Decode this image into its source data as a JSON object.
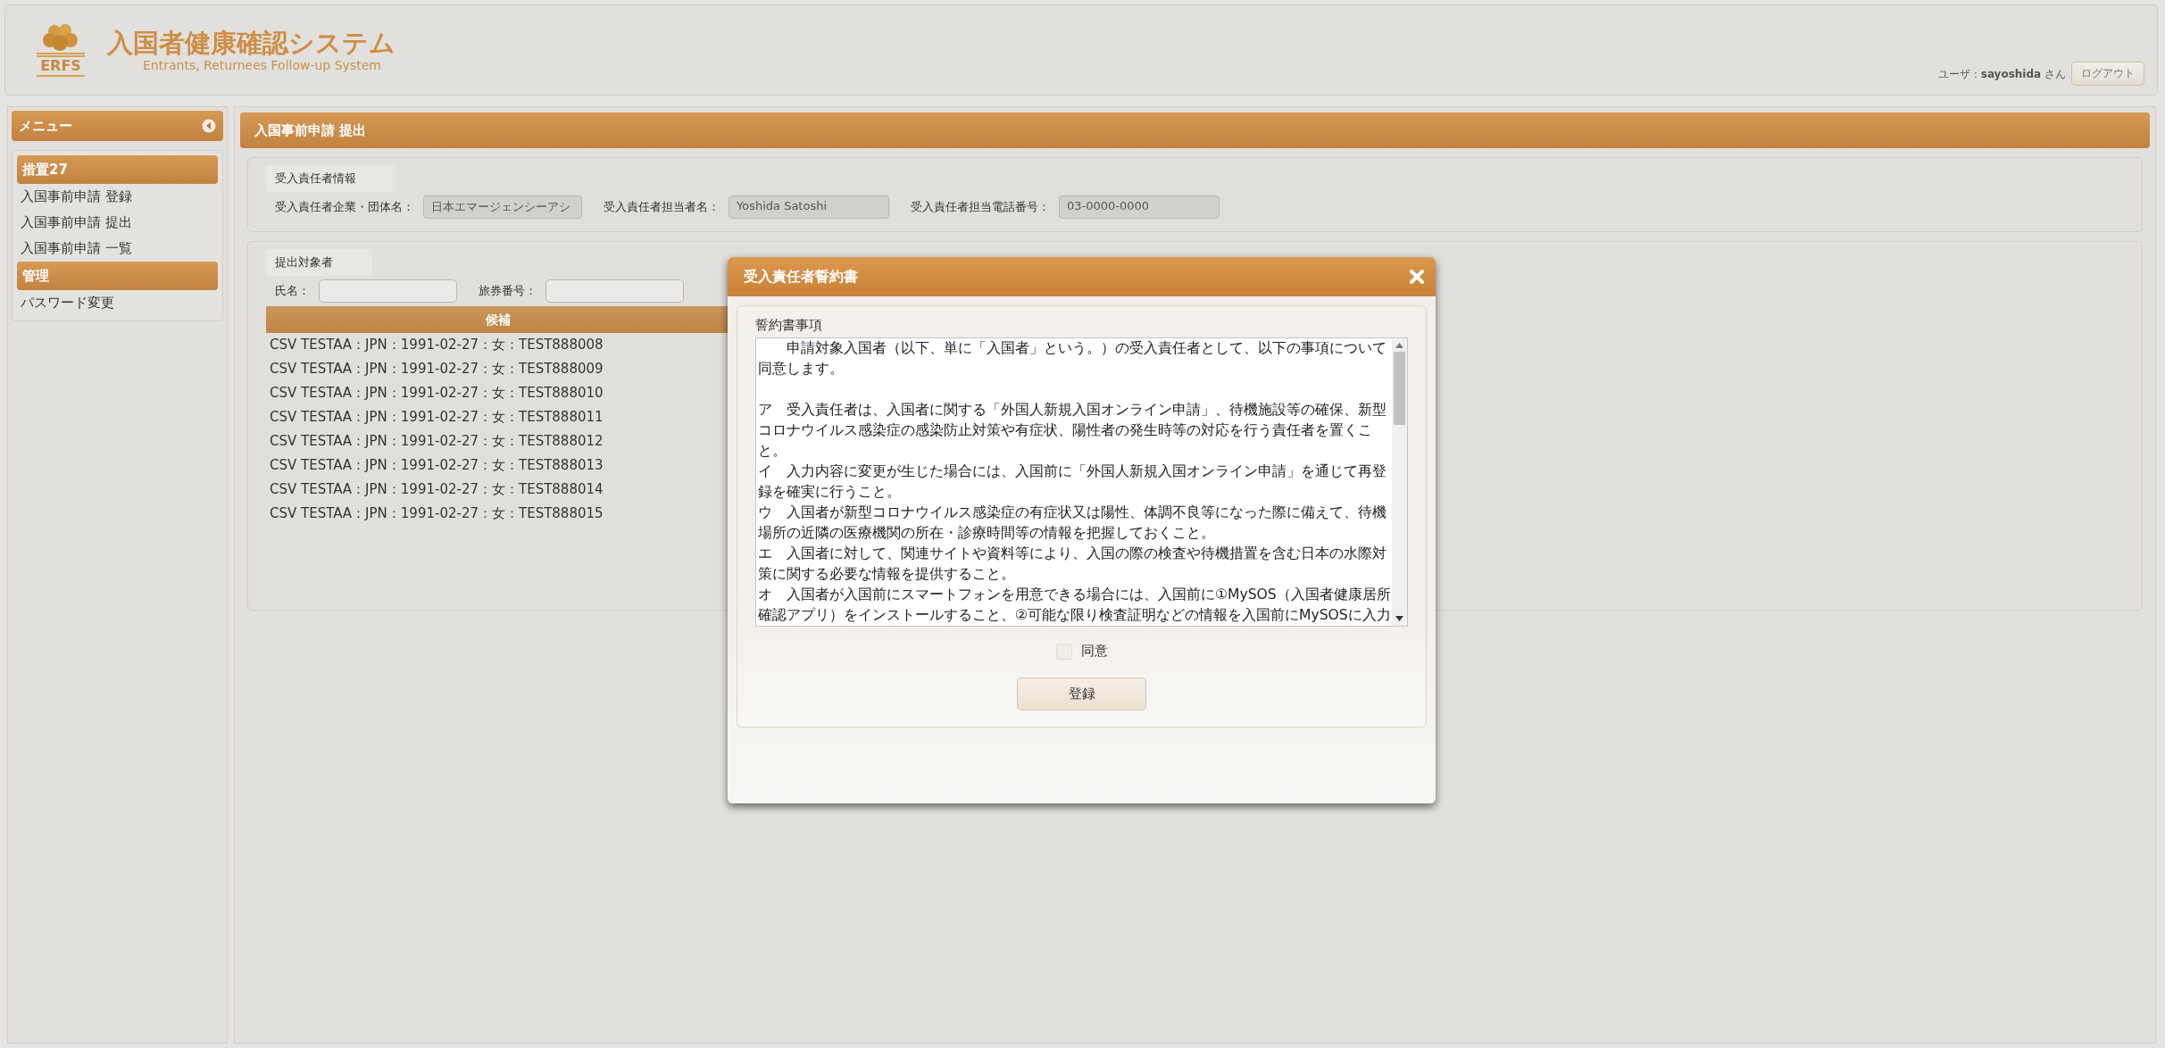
{
  "header": {
    "logo_text": "ERFS",
    "title": "入国者健康確認システム",
    "subtitle": "Entrants, Returnees Follow-up System",
    "user": "ユーザ：**sayoshida** さん",
    "logout_button": "ログアウト"
  },
  "sidebar": {
    "title": "メニュー",
    "sections": [
      {
        "title": "措置27",
        "items": [
          {
            "label": "入国事前申請 登録",
            "selected": false
          },
          {
            "label": "入国事前申請 提出",
            "selected": false
          },
          {
            "label": "入国事前申請 一覧",
            "selected": false
          }
        ]
      },
      {
        "title": "管理",
        "items": [
          {
            "label": "パスワード変更",
            "selected": false
          }
        ]
      }
    ]
  },
  "main": {
    "title": "入国事前申請 提出",
    "responsible": {
      "legend": "受入責任者情報",
      "fields": [
        {
          "label": "受入責任者企業・団体名：",
          "value": "日本エマージェンシーアシ"
        },
        {
          "label": "受入責任者担当者名：",
          "value": "Yoshida Satoshi"
        },
        {
          "label": "受入責任者担当電話番号：",
          "value": "03-0000-0000"
        }
      ]
    },
    "targets": {
      "legend": "提出対象者",
      "filters": [
        {
          "label": "氏名："
        },
        {
          "label": "旅券番号："
        }
      ],
      "list": {
        "header": "候補",
        "rows": [
          "CSV TESTAA：JPN：1991-02-27：女：TEST888008",
          "CSV TESTAA：JPN：1991-02-27：女：TEST888009",
          "CSV TESTAA：JPN：1991-02-27：女：TEST888010",
          "CSV TESTAA：JPN：1991-02-27：女：TEST888011",
          "CSV TESTAA：JPN：1991-02-27：女：TEST888012",
          "CSV TESTAA：JPN：1991-02-27：女：TEST888013",
          "CSV TESTAA：JPN：1991-02-27：女：TEST888014",
          "CSV TESTAA：JPN：1991-02-27：女：TEST888015"
        ]
      }
    }
  },
  "dialog": {
    "title": "受入責任者誓約書",
    "section_label": "誓約書事項",
    "intro": "　　申請対象入国者（以下、単に「入国者」という。）の受入責任者として、以下の事項について同意します。",
    "items": [
      "ア　受入責任者は、入国者に関する「外国人新規入国オンライン申請」、待機施設等の確保、新型コロナウイルス感染症の感染防止対策や有症状、陽性者の発生時等の対応を行う責任者を置くこと。",
      "イ　入力内容に変更が生じた場合には、入国前に「外国人新規入国オンライン申請」を通じて再登録を確実に行うこと。",
      "ウ　入国者が新型コロナウイルス感染症の有症状又は陽性、体調不良等になった際に備えて、待機場所の近隣の医療機関の所在・診療時間等の情報を把握しておくこと。",
      "エ　入国者に対して、関連サイトや資料等により、入国の際の検査や待機措置を含む日本の水際対策に関する必要な情報を提供すること。",
      "オ　入国者が入国前にスマートフォンを用意できる場合には、入国前に①MySOS（入国者健康居所確認アプリ）をインストールすること、②可能な限り検査証明などの情報を入国前にMySOSに入力"
    ],
    "agree": {
      "label": "同意",
      "checked": false
    },
    "submit_button": "登録"
  }
}
